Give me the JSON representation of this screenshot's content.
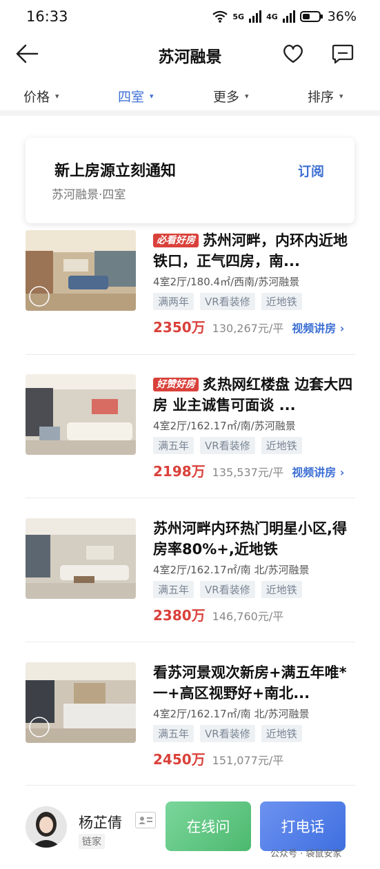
{
  "status": {
    "time": "16:33",
    "network1": "5G",
    "network2": "4G",
    "battery": "36%"
  },
  "nav": {
    "title": "苏河融景"
  },
  "filters": [
    {
      "label": "价格",
      "active": false
    },
    {
      "label": "四室",
      "active": true
    },
    {
      "label": "更多",
      "active": false
    },
    {
      "label": "排序",
      "active": false
    }
  ],
  "notify": {
    "title": "新上房源立刻通知",
    "subtitle": "苏河融景·四室",
    "action": "订阅"
  },
  "listings": [
    {
      "badge": "必看好房",
      "title": "苏州河畔，内环内近地铁口，正气四房，南...",
      "meta": "4室2厅/180.4㎡/西南/苏河融景",
      "tags": [
        "满两年",
        "VR看装修",
        "近地铁"
      ],
      "price": "2350万",
      "unit_price": "130,267元/平",
      "video": "视频讲房 ›"
    },
    {
      "badge": "好赞好房",
      "title": "炙热网红楼盘  边套大四房  业主诚售可面谈 ...",
      "meta": "4室2厅/162.17㎡/南/苏河融景",
      "tags": [
        "满五年",
        "VR看装修",
        "近地铁"
      ],
      "price": "2198万",
      "unit_price": "135,537元/平",
      "video": "视频讲房 ›"
    },
    {
      "badge": "",
      "title": "苏州河畔内环热门明星小区,得房率80%+,近地铁",
      "meta": "4室2厅/162.17㎡/南 北/苏河融景",
      "tags": [
        "满五年",
        "VR看装修",
        "近地铁"
      ],
      "price": "2380万",
      "unit_price": "146,760元/平",
      "video": ""
    },
    {
      "badge": "",
      "title": "看苏河景观次新房+满五年唯*一+高区视野好+南北...",
      "meta": "4室2厅/162.17㎡/南 北/苏河融景",
      "tags": [
        "满五年",
        "VR看装修",
        "近地铁"
      ],
      "price": "2450万",
      "unit_price": "151,077元/平",
      "video": ""
    }
  ],
  "agent": {
    "name": "杨芷倩",
    "agency": "链家"
  },
  "buttons": {
    "chat": "在线问",
    "call": "打电话"
  },
  "watermark": "公众号 · 袋鼠安家",
  "colors": {
    "accent": "#3c6fd3",
    "price": "#d9413a",
    "chat": "#4cb96f",
    "call": "#3e6fe0"
  }
}
